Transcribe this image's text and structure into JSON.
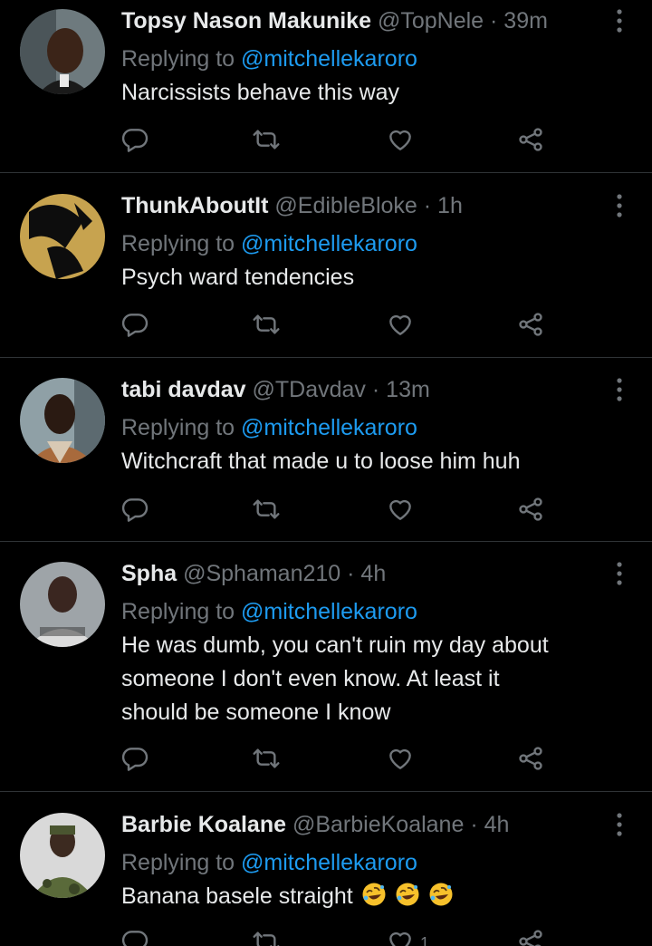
{
  "tweets": [
    {
      "name": "Topsy Nason Makunike",
      "handle": "@TopNele",
      "time": "· 39m",
      "reply_prefix": "Replying to ",
      "mention": "@mitchellekaroro",
      "lines": [
        "Narcissists behave this way"
      ],
      "like_count": ""
    },
    {
      "name": "ThunkAboutIt",
      "handle": "@EdibleBloke",
      "time": "· 1h",
      "reply_prefix": "Replying to ",
      "mention": "@mitchellekaroro",
      "lines": [
        "Psych ward tendencies"
      ],
      "like_count": ""
    },
    {
      "name": "tabi davdav",
      "handle": "@TDavdav",
      "time": "· 13m",
      "reply_prefix": "Replying to ",
      "mention": "@mitchellekaroro",
      "lines": [
        "Witchcraft that made u to loose him huh"
      ],
      "like_count": ""
    },
    {
      "name": "Spha",
      "handle": "@Sphaman210",
      "time": "· 4h",
      "reply_prefix": "Replying to ",
      "mention": "@mitchellekaroro",
      "lines": [
        "He was dumb, you can't ruin my day about",
        "someone I don't even know. At least it",
        "should be someone I know"
      ],
      "like_count": ""
    },
    {
      "name": "Barbie Koalane",
      "handle": "@BarbieKoalane",
      "time": "· 4h",
      "reply_prefix": "Replying to ",
      "mention": "@mitchellekaroro",
      "lines": [
        "Banana basele straight"
      ],
      "emoji": "rolling-on-floor-laughing",
      "emoji_count": 3,
      "like_count": "1"
    }
  ],
  "colors": {
    "background": "#000000",
    "name": "#e7e9ea",
    "secondary": "#71767b",
    "mention": "#1d9bf0",
    "divider": "#2f3336"
  },
  "icons": {
    "reply": "reply-icon",
    "retweet": "retweet-icon",
    "like": "heart-icon",
    "share": "share-icon",
    "more": "more-vertical-icon",
    "emoji": "rolling-laughing-emoji-icon"
  }
}
